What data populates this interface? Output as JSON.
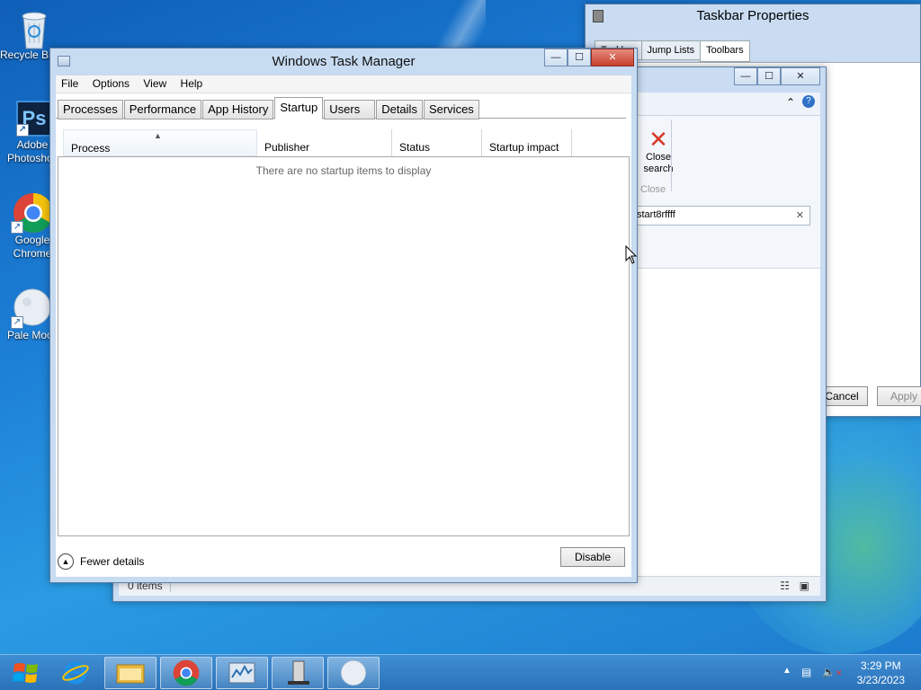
{
  "desktop": {
    "icons": [
      {
        "label": "Recycle Bin"
      },
      {
        "label": "Adobe Photoshop"
      },
      {
        "label": "Google Chrome"
      },
      {
        "label": "Pale Moon"
      }
    ]
  },
  "taskbar_properties": {
    "title": "Taskbar Properties",
    "tabs": [
      "Taskbar",
      "Jump Lists",
      "Toolbars"
    ],
    "active_tab": "Toolbars",
    "buttons": {
      "cancel": "Cancel",
      "apply": "Apply"
    }
  },
  "mid_window": {
    "ribbon": {
      "close_search_label": "Close search",
      "close_group_label": "Close"
    },
    "search_value": "start8rffff",
    "status_text": "0 items"
  },
  "task_manager": {
    "title": "Windows Task Manager",
    "menu": [
      "File",
      "Options",
      "View",
      "Help"
    ],
    "tabs": [
      "Processes",
      "Performance",
      "App History",
      "Startup",
      "Users",
      "Details",
      "Services"
    ],
    "active_tab": "Startup",
    "columns": [
      "Process",
      "Publisher",
      "Status",
      "Startup impact"
    ],
    "empty_message": "There are no startup items to display",
    "fewer_details": "Fewer details",
    "disable_button": "Disable"
  },
  "taskbar": {
    "time": "3:29 PM",
    "date": "3/23/2023"
  },
  "colors": {
    "accent": "#2a72b9",
    "window_frame": "#c7dbf1",
    "close_button": "#c9402e"
  }
}
